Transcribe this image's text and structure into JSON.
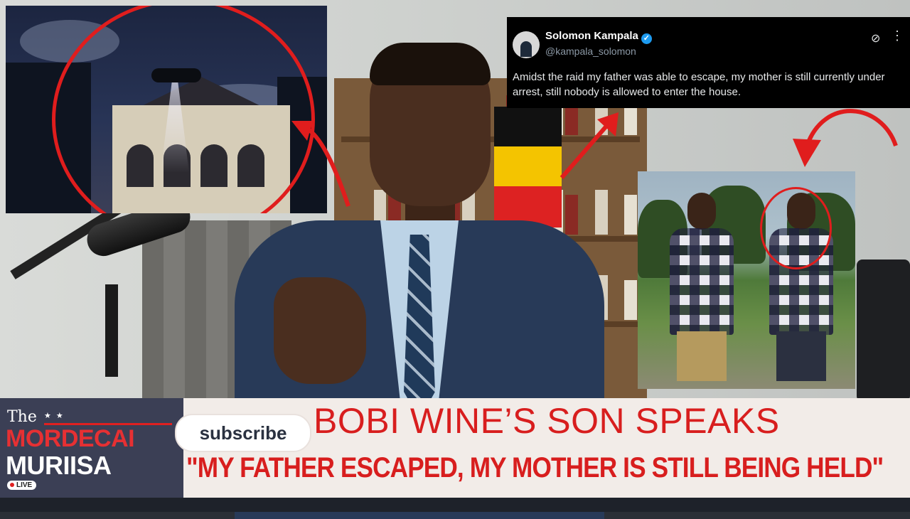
{
  "tweet": {
    "name": "Solomon Kampala",
    "handle": "@kampala_solomon",
    "verified_icon": "verified-badge-icon",
    "text": "Amidst the raid my father was able to escape, my mother is still currently under arrest, still nobody is allowed to enter the house."
  },
  "brand": {
    "the": "The",
    "line1": "MORDECAI",
    "line2": "MURIISA",
    "live": "LIVE",
    "stars": "★ ★"
  },
  "subscribe_label": "subscribe",
  "headline": "BOBI WINE’S SON SPEAKS",
  "quote": "\"MY FATHER ESCAPED, MY MOTHER IS STILL BEING HELD\"",
  "colors": {
    "accent_red": "#d81e1e",
    "brand_bg": "#3b3f55",
    "banner_bg": "#f2ece8",
    "tweet_bg": "#000000",
    "verified_blue": "#1d9bf0"
  }
}
